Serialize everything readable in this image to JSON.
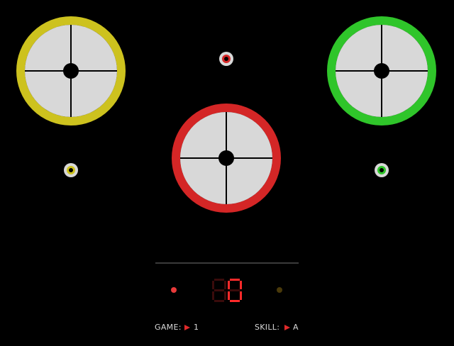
{
  "pads": [
    {
      "name": "yellow",
      "color": "#cdc21e"
    },
    {
      "name": "red",
      "color": "#d42626"
    },
    {
      "name": "green",
      "color": "#2fc52a"
    }
  ],
  "indicators": [
    {
      "name": "yellow",
      "color": "#cdc21e"
    },
    {
      "name": "red",
      "color": "#d42626"
    },
    {
      "name": "green",
      "color": "#2fc52a"
    }
  ],
  "score": {
    "display": "0",
    "digit_color": "#ff2a2a",
    "ghost_color": "#3a0b0b"
  },
  "status_lights": [
    {
      "name": "left",
      "color": "#e83a3a"
    },
    {
      "name": "right",
      "color": "#4a3a0a"
    }
  ],
  "game": {
    "label": "GAME:",
    "value": "1"
  },
  "skill": {
    "label": "SKILL:",
    "value": "A"
  },
  "pad_face_color": "#d8d8d8",
  "divider_color": "#3a3a3a"
}
